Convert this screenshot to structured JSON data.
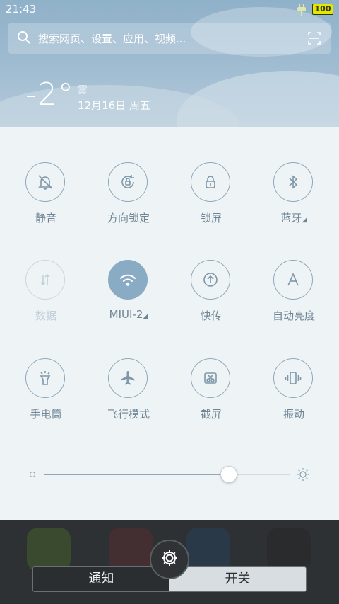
{
  "status_bar": {
    "time": "21:43",
    "battery": "100"
  },
  "search": {
    "placeholder": "搜索网页、设置、应用、视频..."
  },
  "weather": {
    "temperature": "-2°",
    "condition": "雾",
    "date": "12月16日 周五"
  },
  "toggles": [
    {
      "label": "静音",
      "icon": "bell-off-icon",
      "state": "off"
    },
    {
      "label": "方向锁定",
      "icon": "rotation-lock-icon",
      "state": "off"
    },
    {
      "label": "锁屏",
      "icon": "lock-icon",
      "state": "off"
    },
    {
      "label": "蓝牙",
      "icon": "bluetooth-icon",
      "state": "off",
      "has_menu": true
    },
    {
      "label": "数据",
      "icon": "mobile-data-icon",
      "state": "disabled"
    },
    {
      "label": "MIUI-2",
      "icon": "wifi-icon",
      "state": "on",
      "has_menu": true
    },
    {
      "label": "快传",
      "icon": "quick-share-icon",
      "state": "off"
    },
    {
      "label": "自动亮度",
      "icon": "auto-brightness-icon",
      "state": "off"
    },
    {
      "label": "手电筒",
      "icon": "flashlight-icon",
      "state": "off"
    },
    {
      "label": "飞行模式",
      "icon": "airplane-icon",
      "state": "off"
    },
    {
      "label": "截屏",
      "icon": "screenshot-icon",
      "state": "off"
    },
    {
      "label": "振动",
      "icon": "vibrate-icon",
      "state": "off"
    }
  ],
  "brightness": {
    "level": 0.75
  },
  "tabs": {
    "notifications": "通知",
    "toggles": "开关"
  },
  "colors": {
    "accent": "#8aabc4",
    "label": "#6f8595",
    "panel_bg": "#eef3f6"
  }
}
